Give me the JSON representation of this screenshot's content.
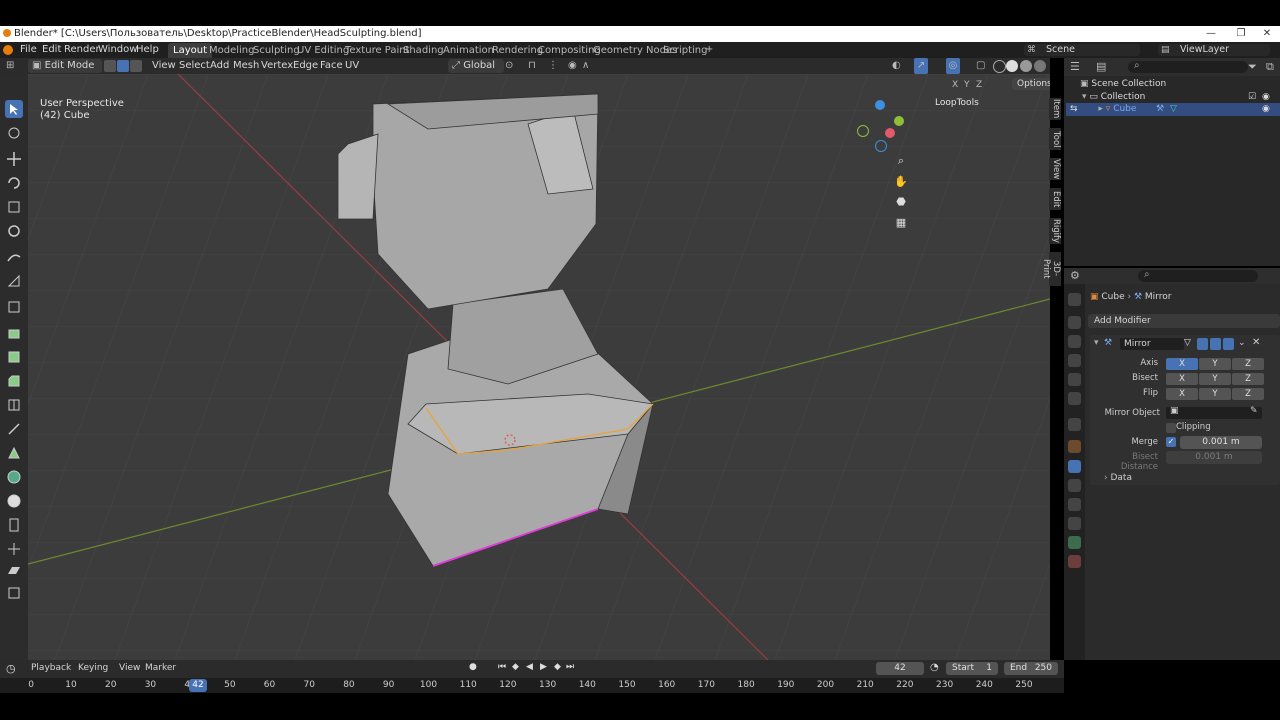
{
  "window": {
    "title": "Blender* [C:\\Users\\Пользователь\\Desktop\\PracticeBlender\\HeadSculpting.blend]",
    "minimize": "—",
    "maximize": "❐",
    "close": "✕"
  },
  "menu": [
    "File",
    "Edit",
    "Render",
    "Window",
    "Help"
  ],
  "workspaces": [
    "Layout",
    "Modeling",
    "Sculpting",
    "UV Editing",
    "Texture Paint",
    "Shading",
    "Animation",
    "Rendering",
    "Compositing",
    "Geometry Nodes",
    "Scripting"
  ],
  "workspace_add": "+",
  "scene": {
    "label": "Scene",
    "view_layer": "ViewLayer"
  },
  "header": {
    "mode": "Edit Mode",
    "items": [
      "View",
      "Select",
      "Add",
      "Mesh",
      "Vertex",
      "Edge",
      "Face",
      "UV"
    ],
    "transform": "Global",
    "options": "Options",
    "xyz": [
      "X",
      "Y",
      "Z"
    ]
  },
  "viewport": {
    "perspective": "User Perspective",
    "object": "(42) Cube",
    "addon": "LoopTools",
    "gizmo_axes": [
      "X",
      "Y",
      "Z"
    ]
  },
  "side_tabs": [
    "Item",
    "Tool",
    "View",
    "Edit",
    "Rigify",
    "3D-Print"
  ],
  "outliner": {
    "root": "Scene Collection",
    "collection": "Collection",
    "object": "Cube"
  },
  "properties": {
    "breadcrumb_object": "Cube",
    "breadcrumb_modifier": "Mirror",
    "add_modifier": "Add Modifier",
    "modifier_name": "Mirror",
    "axis_label": "Axis",
    "bisect_label": "Bisect",
    "flip_label": "Flip",
    "axis_buttons": [
      "X",
      "Y",
      "Z"
    ],
    "mirror_object_label": "Mirror Object",
    "clipping_label": "Clipping",
    "merge_label": "Merge",
    "merge_value": "0.001 m",
    "bisect_distance_label": "Bisect Distance",
    "bisect_distance_value": "0.001 m",
    "data_label": "Data"
  },
  "timeline": {
    "menu": [
      "Playback",
      "Keying",
      "View",
      "Marker"
    ],
    "current_frame": "42",
    "start_label": "Start",
    "start_value": "1",
    "end_label": "End",
    "end_value": "250",
    "ticks": [
      "0",
      "10",
      "20",
      "30",
      "40",
      "50",
      "60",
      "70",
      "80",
      "90",
      "100",
      "110",
      "120",
      "130",
      "140",
      "150",
      "160",
      "170",
      "180",
      "190",
      "200",
      "210",
      "220",
      "230",
      "240",
      "250"
    ],
    "playhead": "42"
  },
  "colors": {
    "accent": "#4772b3",
    "x_axis": "#e05a6a",
    "y_axis": "#8fbf3a",
    "z_axis": "#3d8fe0",
    "selection_edge": "#e8a33a",
    "seam_edge": "#e03ad8"
  }
}
